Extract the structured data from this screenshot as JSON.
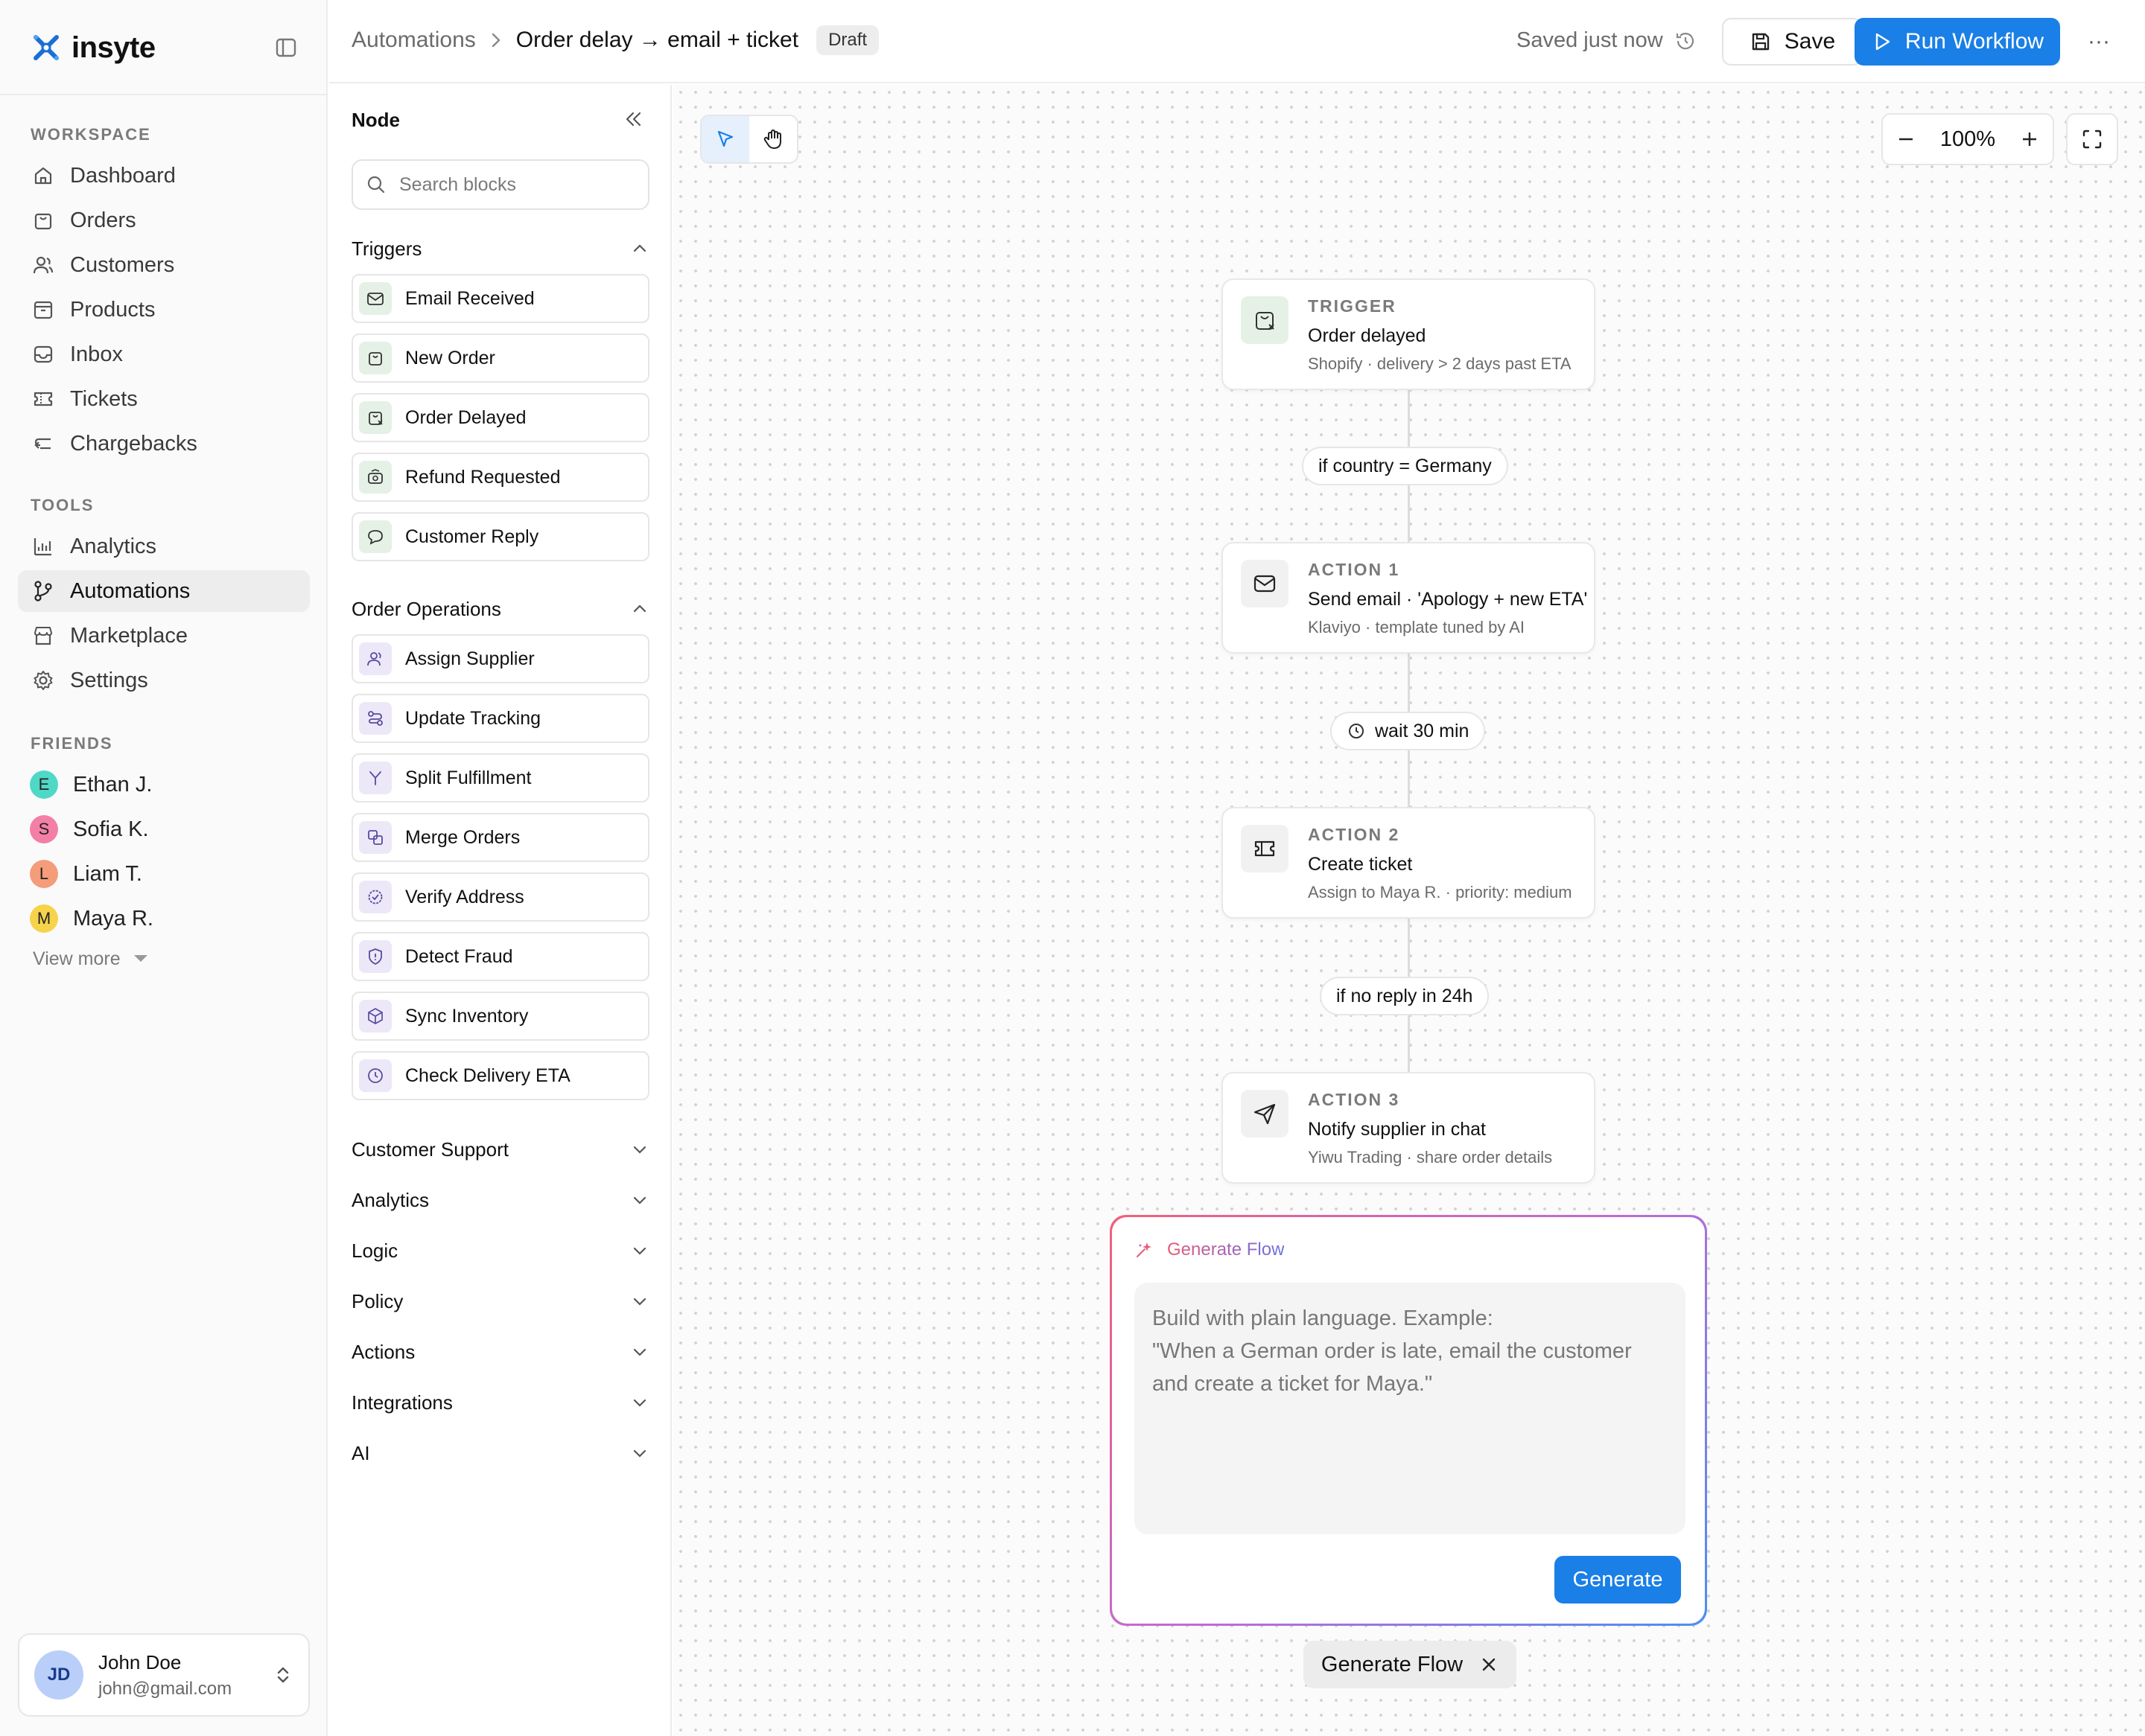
{
  "app": {
    "name": "insyte"
  },
  "sidebar": {
    "workspace_label": "WORKSPACE",
    "workspace_items": [
      {
        "label": "Dashboard",
        "icon": "home-icon"
      },
      {
        "label": "Orders",
        "icon": "bag-icon"
      },
      {
        "label": "Customers",
        "icon": "users-icon"
      },
      {
        "label": "Products",
        "icon": "box-icon"
      },
      {
        "label": "Inbox",
        "icon": "inbox-icon"
      },
      {
        "label": "Tickets",
        "icon": "ticket-icon"
      },
      {
        "label": "Chargebacks",
        "icon": "return-arrow-icon"
      }
    ],
    "tools_label": "TOOLS",
    "tools_items": [
      {
        "label": "Analytics",
        "icon": "chart-icon"
      },
      {
        "label": "Automations",
        "icon": "branch-icon",
        "active": true
      },
      {
        "label": "Marketplace",
        "icon": "store-icon"
      },
      {
        "label": "Settings",
        "icon": "gear-icon"
      }
    ],
    "friends_label": "FRIENDS",
    "friends": [
      {
        "initial": "E",
        "name": "Ethan J.",
        "color": "#4fd8c6"
      },
      {
        "initial": "S",
        "name": "Sofia K.",
        "color": "#f37fa6"
      },
      {
        "initial": "L",
        "name": "Liam T.",
        "color": "#f59c7a"
      },
      {
        "initial": "M",
        "name": "Maya R.",
        "color": "#f6d34a"
      }
    ],
    "view_more": "View more",
    "user": {
      "initials": "JD",
      "name": "John Doe",
      "email": "john@gmail.com"
    }
  },
  "header": {
    "breadcrumb_root": "Automations",
    "breadcrumb_sep": ">",
    "breadcrumb_current": "Order delay → email + ticket",
    "status_badge": "Draft",
    "saved_text": "Saved just now",
    "save_label": "Save",
    "run_label": "Run Workflow",
    "more_label": "···"
  },
  "panel": {
    "title": "Node",
    "search_placeholder": "Search blocks",
    "triggers": {
      "label": "Triggers",
      "items": [
        "Email Received",
        "New Order",
        "Order Delayed",
        "Refund Requested",
        "Customer Reply"
      ]
    },
    "order_ops": {
      "label": "Order Operations",
      "items": [
        "Assign Supplier",
        "Update Tracking",
        "Split Fulfillment",
        "Merge Orders",
        "Verify Address",
        "Detect Fraud",
        "Sync Inventory",
        "Check Delivery ETA"
      ]
    },
    "collapsed_groups": [
      "Customer Support",
      "Analytics",
      "Logic",
      "Policy",
      "Actions",
      "Integrations",
      "AI"
    ]
  },
  "canvas": {
    "zoom": "100%",
    "nodes": [
      {
        "kind": "TRIGGER",
        "title": "Order delayed",
        "sub": "Shopify · delivery > 2 days past ETA"
      },
      {
        "kind": "ACTION 1",
        "title": "Send email · 'Apology + new ETA'",
        "sub": "Klaviyo · template tuned by AI"
      },
      {
        "kind": "ACTION 2",
        "title": "Create ticket",
        "sub": "Assign to Maya R. · priority: medium"
      },
      {
        "kind": "ACTION 3",
        "title": "Notify supplier in chat",
        "sub": "Yiwu Trading · share order details"
      }
    ],
    "connectors": [
      "if country = Germany",
      "wait 30 min",
      "if no reply in 24h"
    ],
    "generate": {
      "title": "Generate Flow",
      "placeholder": "Build with plain language. Example:\n\"When a German order is late, email the customer and create a ticket for Maya.\"",
      "button": "Generate",
      "toggle_label": "Generate Flow"
    }
  },
  "colors": {
    "accent": "#1a7fe6",
    "brand": "#1a6fd6"
  }
}
